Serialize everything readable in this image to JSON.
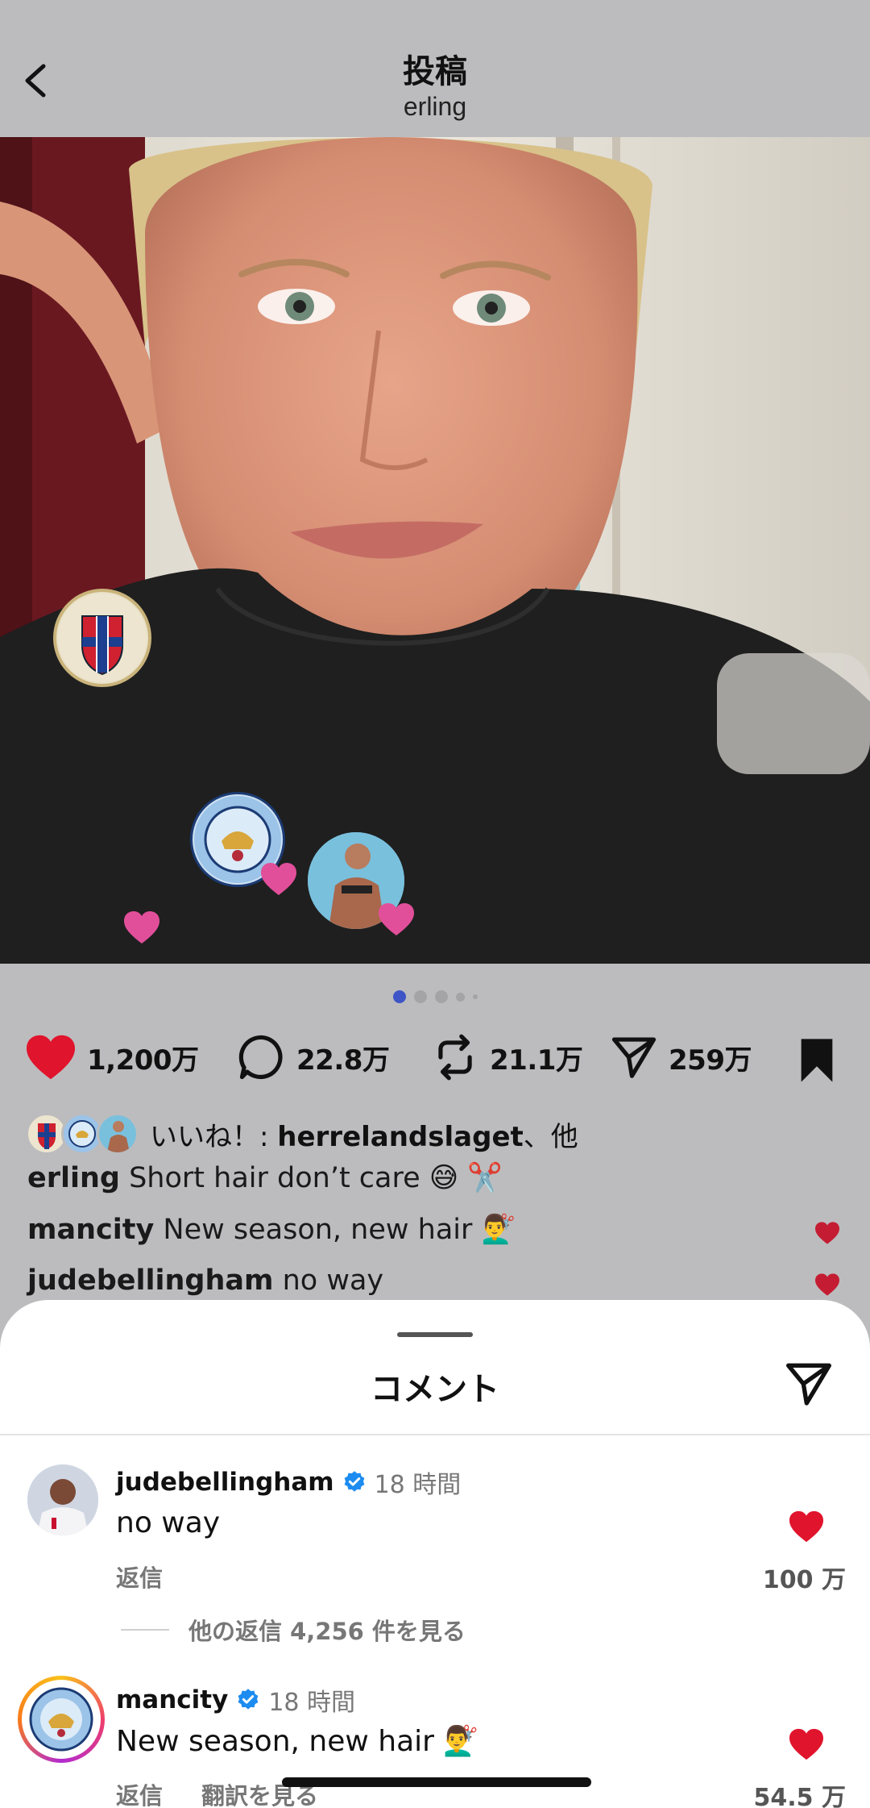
{
  "header": {
    "title": "投稿",
    "subtitle": "erling"
  },
  "photo": {
    "tags": [
      {
        "name": "norway-crest"
      },
      {
        "name": "mancity-crest"
      },
      {
        "name": "person-avatar"
      }
    ]
  },
  "carousel": {
    "count": 5,
    "active": 0
  },
  "actions": {
    "likes": "1,200万",
    "comments": "22.8万",
    "reposts": "21.1万",
    "shares": "259万"
  },
  "liked_by": {
    "prefix": "いいね！: ",
    "user": "herrelandslaget",
    "suffix": "、他"
  },
  "captions": [
    {
      "user": "erling",
      "text": " Short hair don’t care 😅 ✂️"
    },
    {
      "user": "mancity",
      "text": " New season, new hair 💇‍♂️"
    },
    {
      "user": "judebellingham",
      "text": " no way"
    }
  ],
  "sheet": {
    "title": "コメント"
  },
  "comments": [
    {
      "user": "judebellingham",
      "time": "18 時間",
      "text": "no way",
      "reply": "返信",
      "likes": "100 万",
      "more_replies": "他の返信 4,256 件を見る"
    },
    {
      "user": "mancity",
      "time": "18 時間",
      "text": "New season, new hair 💇‍♂️",
      "reply": "返信",
      "translate": "翻訳を見る",
      "likes": "54.5 万"
    }
  ],
  "colors": {
    "heart": "#e0142c",
    "accent": "#3d55c6",
    "verified": "#1d8cf0",
    "background": "#bcbcbe"
  }
}
